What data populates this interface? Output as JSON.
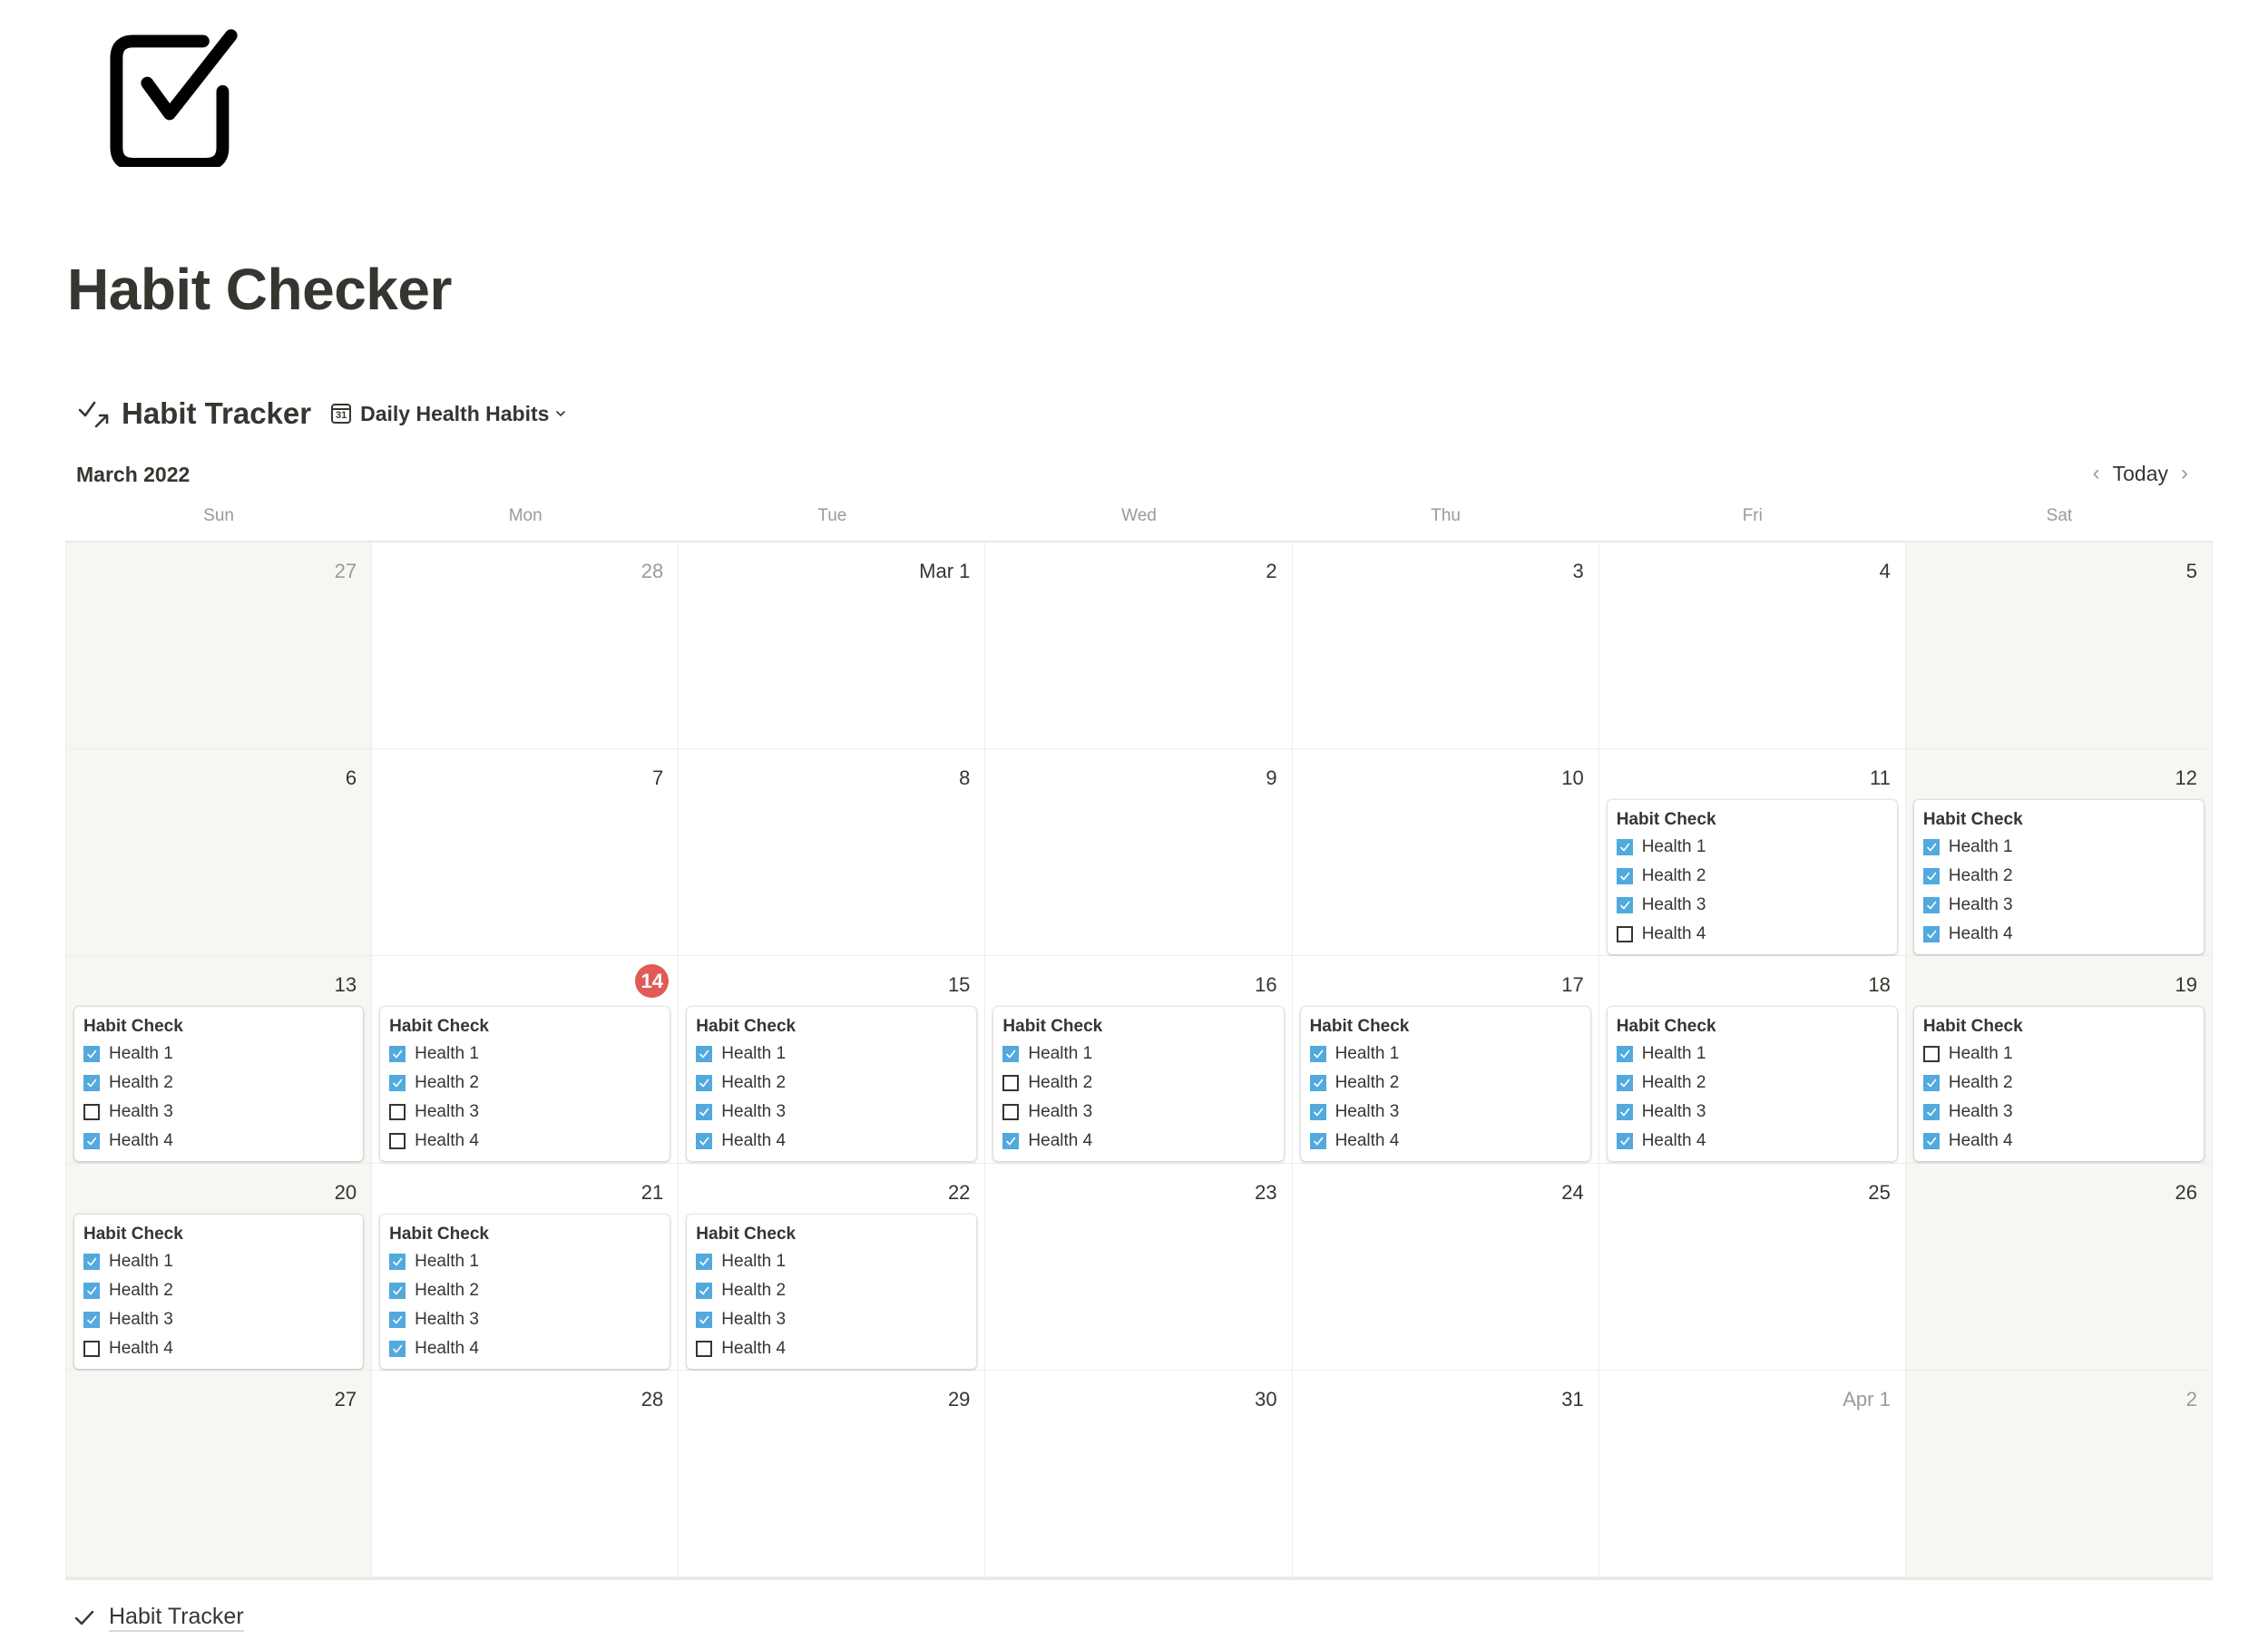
{
  "page": {
    "icon": "checkbox-checked-icon",
    "title": "Habit Checker"
  },
  "database": {
    "icon": "checklist-arrow-icon",
    "title": "Habit Tracker",
    "view": {
      "icon": "calendar-icon",
      "icon_text": "31",
      "label": "Daily Health Habits",
      "chevron": "chevron-down-icon"
    }
  },
  "calendar": {
    "month_label": "March 2022",
    "nav": {
      "prev": "‹",
      "today": "Today",
      "next": "›"
    },
    "weekdays": [
      "Sun",
      "Mon",
      "Tue",
      "Wed",
      "Thu",
      "Fri",
      "Sat"
    ],
    "today_color": "#e05b55",
    "checkbox_color": "#52a9de",
    "card_title": "Habit Check",
    "habit_labels": [
      "Health 1",
      "Health 2",
      "Health 3",
      "Health 4"
    ],
    "days": [
      {
        "label": "27",
        "other": true
      },
      {
        "label": "28",
        "other": true
      },
      {
        "label": "Mar 1"
      },
      {
        "label": "2"
      },
      {
        "label": "3"
      },
      {
        "label": "4"
      },
      {
        "label": "5"
      },
      {
        "label": "6"
      },
      {
        "label": "7"
      },
      {
        "label": "8"
      },
      {
        "label": "9"
      },
      {
        "label": "10"
      },
      {
        "label": "11",
        "checks": [
          true,
          true,
          true,
          false
        ]
      },
      {
        "label": "12",
        "checks": [
          true,
          true,
          true,
          true
        ]
      },
      {
        "label": "13",
        "checks": [
          true,
          true,
          false,
          true
        ]
      },
      {
        "label": "14",
        "today": true,
        "checks": [
          true,
          true,
          false,
          false
        ]
      },
      {
        "label": "15",
        "checks": [
          true,
          true,
          true,
          true
        ]
      },
      {
        "label": "16",
        "checks": [
          true,
          false,
          false,
          true
        ]
      },
      {
        "label": "17",
        "checks": [
          true,
          true,
          true,
          true
        ]
      },
      {
        "label": "18",
        "checks": [
          true,
          true,
          true,
          true
        ]
      },
      {
        "label": "19",
        "checks": [
          false,
          true,
          true,
          true
        ]
      },
      {
        "label": "20",
        "checks": [
          true,
          true,
          true,
          false
        ]
      },
      {
        "label": "21",
        "checks": [
          true,
          true,
          true,
          true
        ]
      },
      {
        "label": "22",
        "checks": [
          true,
          true,
          true,
          false
        ]
      },
      {
        "label": "23"
      },
      {
        "label": "24"
      },
      {
        "label": "25"
      },
      {
        "label": "26"
      },
      {
        "label": "27"
      },
      {
        "label": "28"
      },
      {
        "label": "29"
      },
      {
        "label": "30"
      },
      {
        "label": "31"
      },
      {
        "label": "Apr 1",
        "other": true
      },
      {
        "label": "2",
        "other": true
      }
    ]
  },
  "footer": {
    "icon": "checkmark-icon",
    "link_label": "Habit Tracker"
  }
}
